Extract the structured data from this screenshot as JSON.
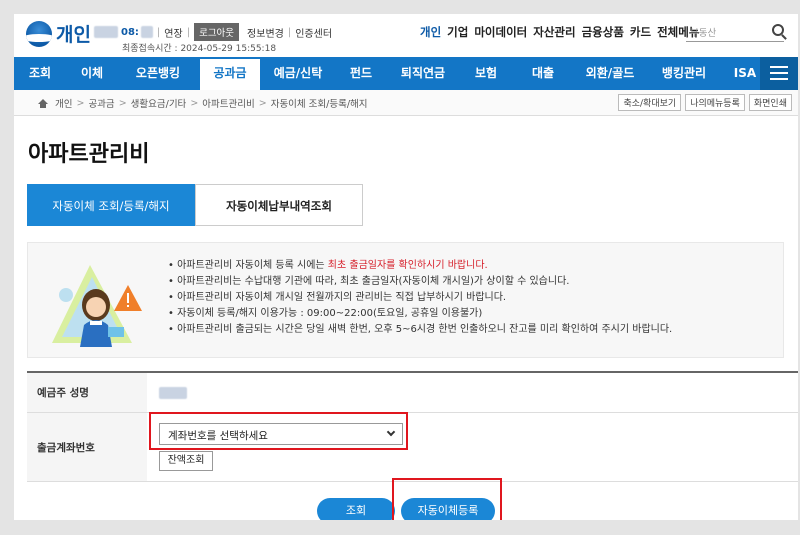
{
  "header": {
    "logo_text": "개인",
    "session_timer": "08:",
    "extend_label": "연장",
    "logout_label": "로그아웃",
    "profile_change": "정보변경",
    "cert_center": "인증센터",
    "last_login_label": "최종접속시간 :",
    "last_login_time": "2024-05-29 15:55:18",
    "nav": [
      "개인",
      "기업",
      "마이데이터",
      "자산관리",
      "금융상품",
      "카드",
      "전체메뉴"
    ],
    "search_placeholder": "부동산"
  },
  "gnb": {
    "items": [
      "조회",
      "이체",
      "오픈뱅킹",
      "공과금",
      "예금/신탁",
      "펀드",
      "퇴직연금",
      "보험",
      "대출",
      "외환/골드",
      "뱅킹관리",
      "ISA"
    ],
    "active_index": 3
  },
  "breadcrumb": {
    "items": [
      "개인",
      "공과금",
      "생활요금/기타",
      "아파트관리비",
      "자동이체 조회/등록/해지"
    ],
    "buttons": [
      "축소/확대보기",
      "나의메뉴등록",
      "화면인쇄"
    ]
  },
  "page_title": "아파트관리비",
  "tabs": [
    "자동이체 조회/등록/해지",
    "자동이체납부내역조회"
  ],
  "notices": [
    {
      "text": "아파트관리비 자동이체 등록 시에는 ",
      "highlight": "최초 출금일자를 확인하시기 바랍니다."
    },
    {
      "text": "아파트관리비는 수납대행 기관에 따라, 최초 출금일자(자동이체 개시일)가 상이할 수 있습니다.",
      "highlight": ""
    },
    {
      "text": "아파트관리비 자동이체 개시일 전월까지의 관리비는 직접 납부하시기 바랍니다.",
      "highlight": ""
    },
    {
      "text": "자동이체 등록/해지 이용가능 : 09:00~22:00(토요일, 공휴일 이용불가)",
      "highlight": ""
    },
    {
      "text": "아파트관리비 출금되는 시간은 당일 새벽 한번, 오후 5~6시경 한번 인출하오니 잔고를 미리 확인하여 주시기 바랍니다.",
      "highlight": ""
    }
  ],
  "form": {
    "depositor_label": "예금주 성명",
    "account_label": "출금계좌번호",
    "account_select": "계좌번호를 선택하세요",
    "balance_button": "잔액조회"
  },
  "actions": {
    "query": "조회",
    "register": "자동이체등록"
  },
  "colors": {
    "primary": "#1376c6",
    "tab_active": "#1b87d6",
    "highlight_red": "#e0161e",
    "notice_red": "#d6202b"
  }
}
